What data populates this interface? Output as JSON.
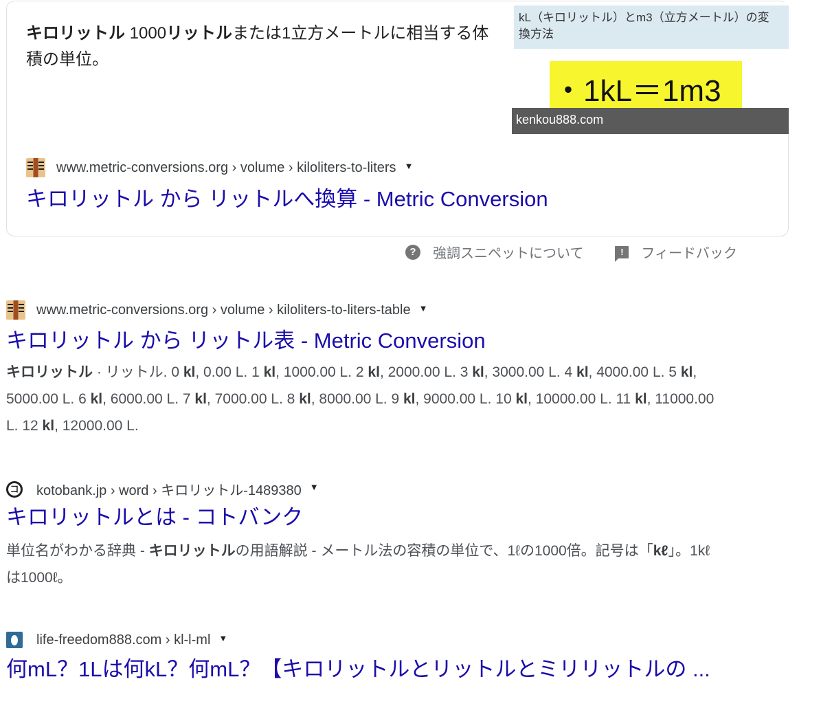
{
  "featured_snippet": {
    "text_parts": [
      {
        "text": "キロリットル",
        "bold": true
      },
      {
        "text": " 1000",
        "bold": false
      },
      {
        "text": "リットル",
        "bold": true
      },
      {
        "text": "または1立方メートルに相当する体積の単位。",
        "bold": false
      }
    ],
    "image": {
      "header_text": "kL（キロリットル）とm3（立方メートル）の変換方法",
      "formula": "・1kL＝1m3",
      "caption": "kenkou888.com"
    },
    "result": {
      "favicon": "metric-conversions-favicon",
      "breadcrumb": "www.metric-conversions.org › volume › kiloliters-to-liters",
      "title": "キロリットル から リットルへ換算 - Metric Conversion"
    }
  },
  "footer": {
    "about_label": "強調スニペットについて",
    "feedback_label": "フィードバック"
  },
  "results": [
    {
      "favicon": "metric-conversions-favicon",
      "breadcrumb": "www.metric-conversions.org › volume › kiloliters-to-liters-table",
      "title": "キロリットル から リットル表 - Metric Conversion",
      "snippet_html": "<b>キロリットル</b> · リットル. 0 <b>kl</b>, 0.00 L. 1 <b>kl</b>, 1000.00 L. 2 <b>kl</b>, 2000.00 L. 3 <b>kl</b>, 3000.00 L. 4 <b>kl</b>, 4000.00 L. 5 <b>kl</b>, 5000.00 L. 6 <b>kl</b>, 6000.00 L. 7 <b>kl</b>, 7000.00 L. 8 <b>kl</b>, 8000.00 L. 9 <b>kl</b>, 9000.00 L. 10 <b>kl</b>, 10000.00 L. 11 <b>kl</b>, 11000.00 L. 12 <b>kl</b>, 12000.00 L."
    },
    {
      "favicon": "kotobank-favicon",
      "favicon_glyph": "コ",
      "breadcrumb": "kotobank.jp › word › キロリットル-1489380",
      "title": "キロリットルとは - コトバンク",
      "snippet_html": "単位名がわかる辞典 - <b>キロリットル</b>の用語解説 - メートル法の容積の単位で、1ℓの1000倍。記号は「<b>kℓ</b>」。1kℓは1000ℓ。"
    },
    {
      "favicon": "life-freedom-favicon",
      "breadcrumb": "life-freedom888.com › kl-l-ml",
      "title": "何mL？1Lは何kL？何mL？【キロリットルとリットルとミリリットルの ..."
    }
  ],
  "dropdown_icon": "▼"
}
